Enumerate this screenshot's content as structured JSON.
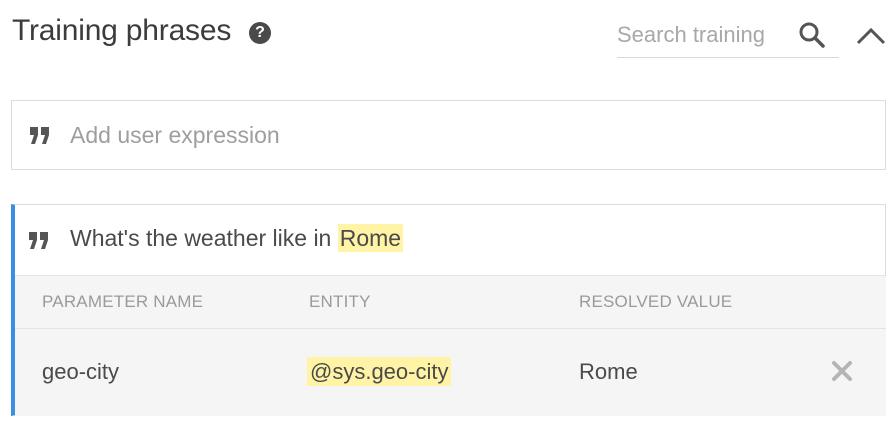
{
  "header": {
    "title": "Training phrases",
    "help_icon": "question-circle-icon",
    "search_placeholder": "Search training",
    "search_icon": "search-icon",
    "collapse_icon": "chevron-up-icon"
  },
  "add_expression": {
    "quote_icon": "quote-icon",
    "placeholder": "Add user expression"
  },
  "phrases": [
    {
      "text_before": "What's the weather like in ",
      "highlight": "Rome",
      "parameter_table": {
        "columns": [
          "PARAMETER NAME",
          "ENTITY",
          "RESOLVED VALUE"
        ],
        "rows": [
          {
            "parameter_name": "geo-city",
            "entity": "@sys.geo-city",
            "resolved_value": "Rome"
          }
        ]
      }
    }
  ],
  "colors": {
    "accent": "#3a8ee6",
    "highlight": "#fff3a6",
    "text": "#4a4a4a",
    "muted": "#9a9a9a"
  }
}
